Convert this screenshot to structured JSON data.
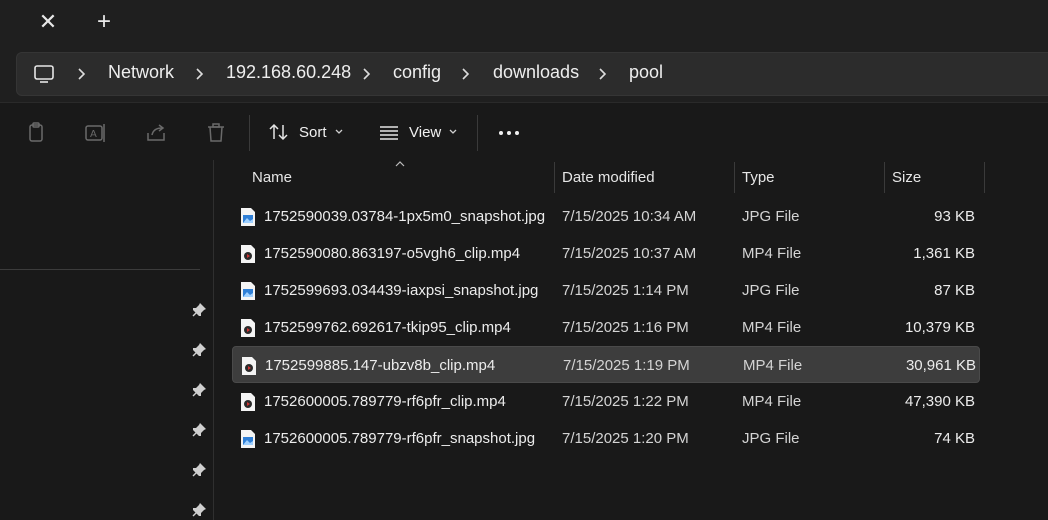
{
  "window": {
    "tab_close_glyph": "✕",
    "tab_new_glyph": "+"
  },
  "address_bar": {
    "root_icon": "this-pc-icon",
    "crumbs": [
      "Network",
      "192.168.60.248",
      "config",
      "downloads",
      "pool"
    ]
  },
  "toolbar": {
    "icons": [
      "copy-icon",
      "rename-icon",
      "share-icon",
      "delete-icon"
    ],
    "sort_label": "Sort",
    "view_label": "View",
    "more_icon": "more-icon"
  },
  "columns": {
    "name": "Name",
    "date": "Date modified",
    "type": "Type",
    "size": "Size",
    "sorted_by": "name"
  },
  "files": [
    {
      "name": "1752590039.03784-1px5m0_snapshot.jpg",
      "date": "7/15/2025 10:34 AM",
      "type": "JPG File",
      "size": "93 KB",
      "icon": "jpg-file-icon",
      "selected": false
    },
    {
      "name": "1752590080.863197-o5vgh6_clip.mp4",
      "date": "7/15/2025 10:37 AM",
      "type": "MP4 File",
      "size": "1,361 KB",
      "icon": "mp4-file-icon",
      "selected": false
    },
    {
      "name": "1752599693.034439-iaxpsi_snapshot.jpg",
      "date": "7/15/2025 1:14 PM",
      "type": "JPG File",
      "size": "87 KB",
      "icon": "jpg-file-icon",
      "selected": false
    },
    {
      "name": "1752599762.692617-tkip95_clip.mp4",
      "date": "7/15/2025 1:16 PM",
      "type": "MP4 File",
      "size": "10,379 KB",
      "icon": "mp4-file-icon",
      "selected": false
    },
    {
      "name": "1752599885.147-ubzv8b_clip.mp4",
      "date": "7/15/2025 1:19 PM",
      "type": "MP4 File",
      "size": "30,961 KB",
      "icon": "mp4-file-icon",
      "selected": true
    },
    {
      "name": "1752600005.789779-rf6pfr_clip.mp4",
      "date": "7/15/2025 1:22 PM",
      "type": "MP4 File",
      "size": "47,390 KB",
      "icon": "mp4-file-icon",
      "selected": false
    },
    {
      "name": "1752600005.789779-rf6pfr_snapshot.jpg",
      "date": "7/15/2025 1:20 PM",
      "type": "JPG File",
      "size": "74 KB",
      "icon": "jpg-file-icon",
      "selected": false
    }
  ],
  "nav_pane": {
    "pinned_count": 6,
    "pin_icon": "pin-icon"
  },
  "colors": {
    "background": "#191919",
    "chrome": "#1f1f1f",
    "address_field": "#2c2c2c",
    "selection": "#3d3d3d",
    "jpg_accent": "#2f7fd6",
    "mp4_accent": "#6d2a2a"
  }
}
